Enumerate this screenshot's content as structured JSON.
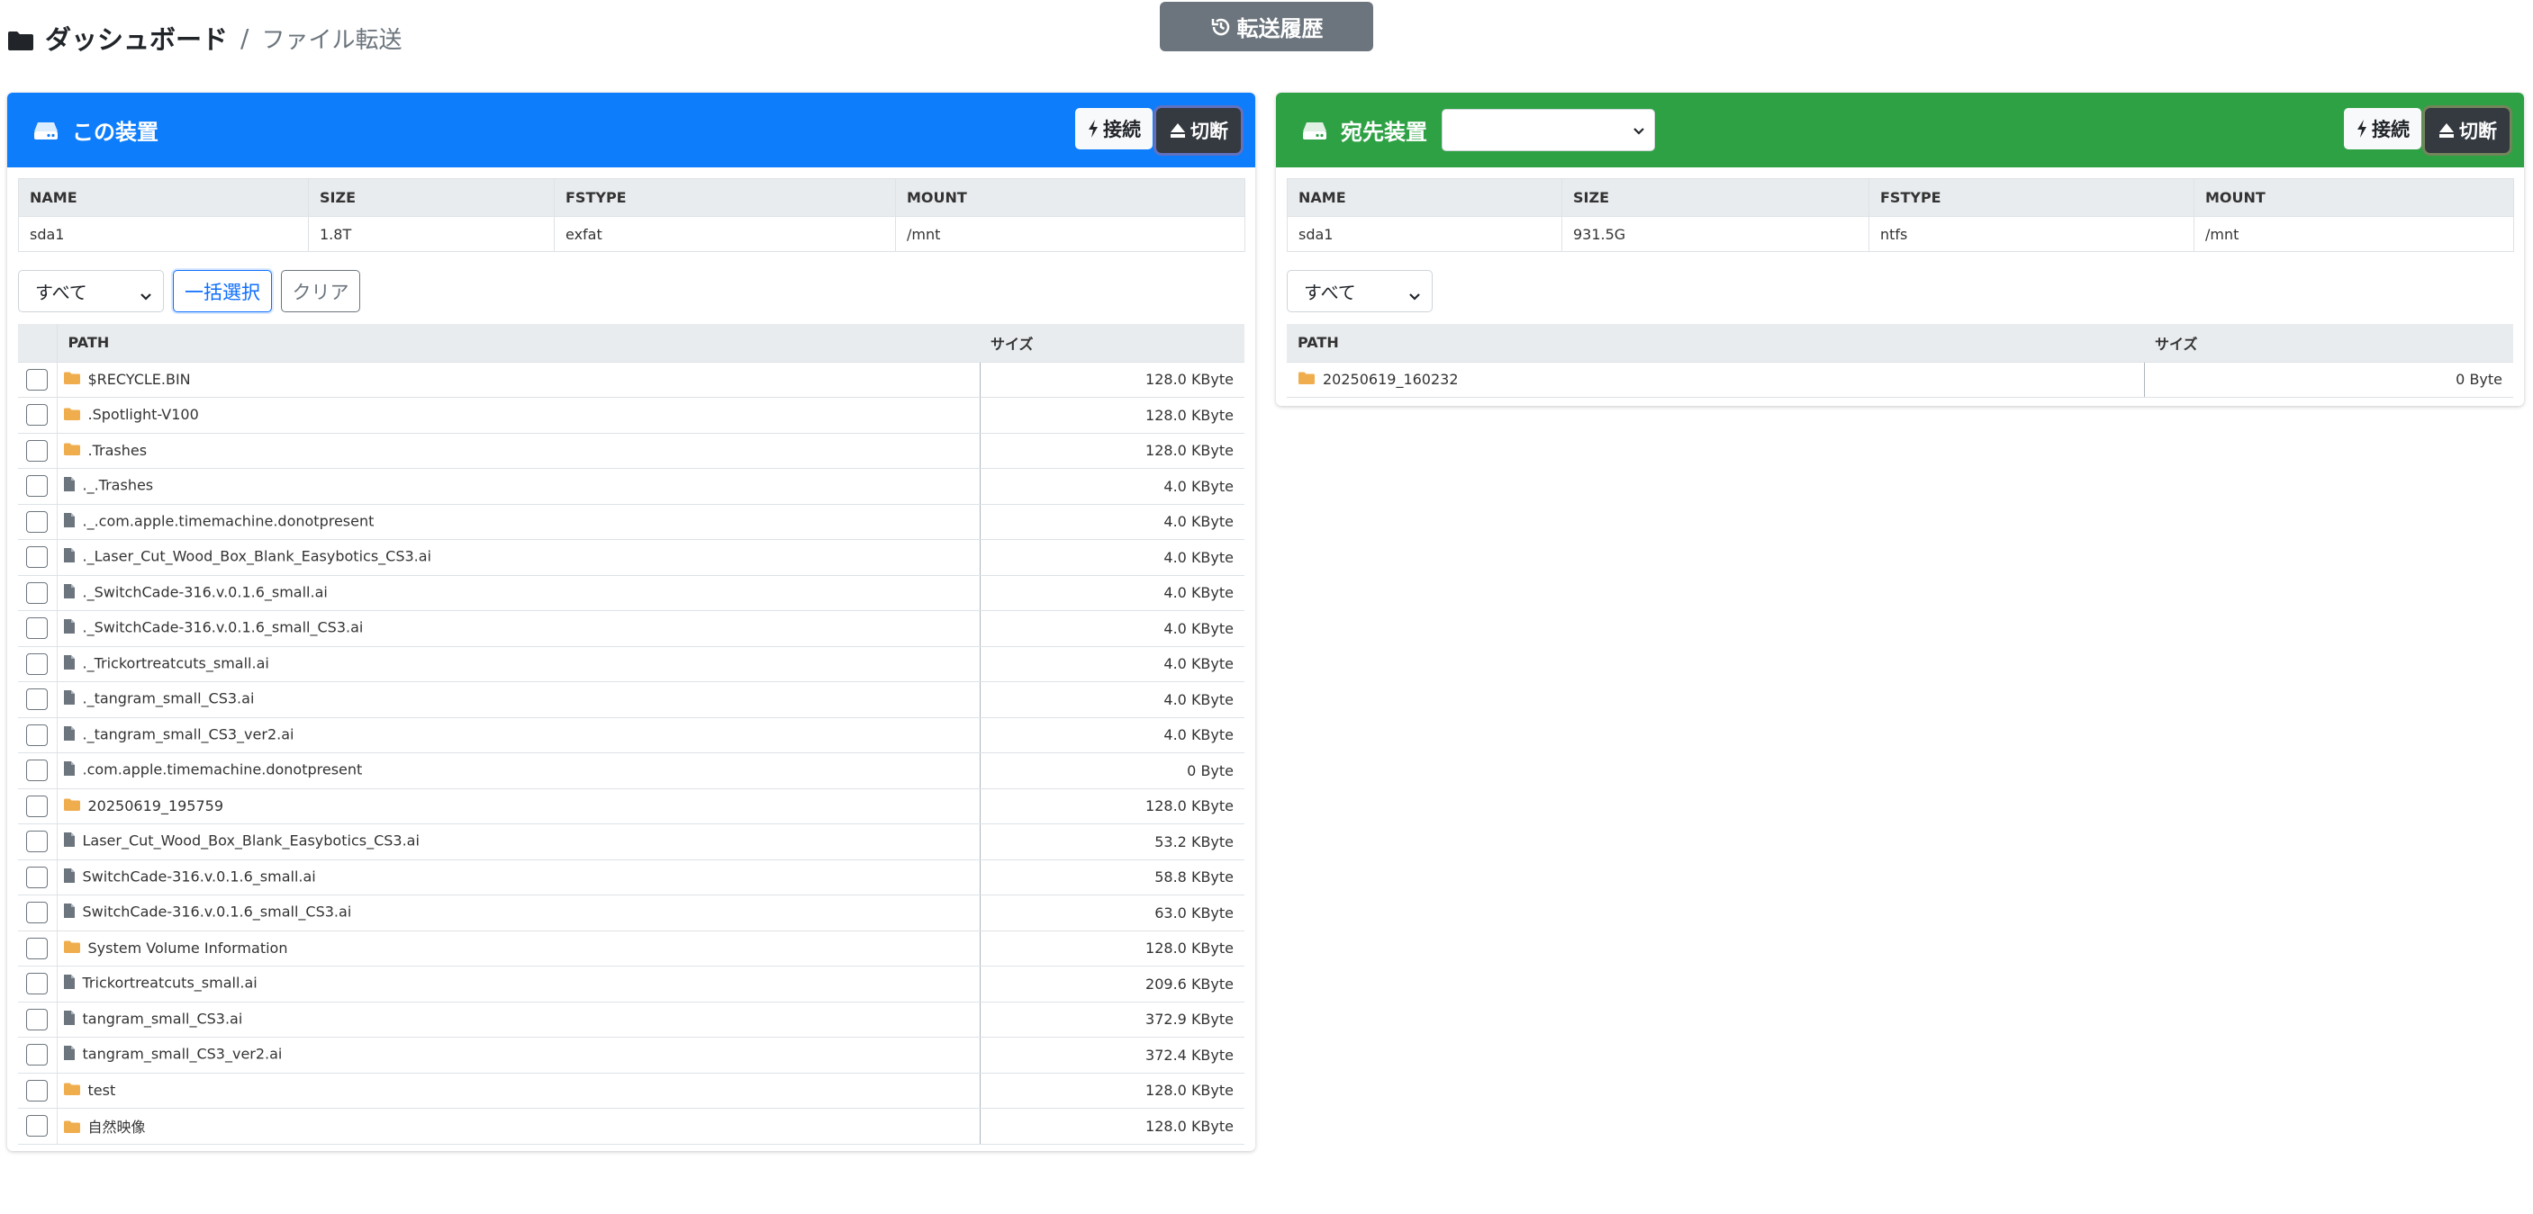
{
  "breadcrumb": {
    "home": "ダッシュボード",
    "separator": "/",
    "current": "ファイル転送"
  },
  "history_button": {
    "label": "転送履歴"
  },
  "left_panel": {
    "title": "この装置",
    "connect_label": "接続",
    "disconnect_label": "切断",
    "device_table": {
      "headers": [
        "NAME",
        "SIZE",
        "FSTYPE",
        "MOUNT"
      ],
      "row": [
        "sda1",
        "1.8T",
        "exfat",
        "/mnt"
      ]
    },
    "filter_value": "すべて",
    "select_all_label": "一括選択",
    "clear_label": "クリア",
    "file_table": {
      "headers": [
        "PATH",
        "サイズ"
      ],
      "rows": [
        {
          "type": "folder",
          "path": "$RECYCLE.BIN",
          "size": "128.0 KByte"
        },
        {
          "type": "folder",
          "path": ".Spotlight-V100",
          "size": "128.0 KByte"
        },
        {
          "type": "folder",
          "path": ".Trashes",
          "size": "128.0 KByte"
        },
        {
          "type": "file",
          "path": "._.Trashes",
          "size": "4.0 KByte"
        },
        {
          "type": "file",
          "path": "._.com.apple.timemachine.donotpresent",
          "size": "4.0 KByte"
        },
        {
          "type": "file",
          "path": "._Laser_Cut_Wood_Box_Blank_Easybotics_CS3.ai",
          "size": "4.0 KByte"
        },
        {
          "type": "file",
          "path": "._SwitchCade-316.v.0.1.6_small.ai",
          "size": "4.0 KByte"
        },
        {
          "type": "file",
          "path": "._SwitchCade-316.v.0.1.6_small_CS3.ai",
          "size": "4.0 KByte"
        },
        {
          "type": "file",
          "path": "._Trickortreatcuts_small.ai",
          "size": "4.0 KByte"
        },
        {
          "type": "file",
          "path": "._tangram_small_CS3.ai",
          "size": "4.0 KByte"
        },
        {
          "type": "file",
          "path": "._tangram_small_CS3_ver2.ai",
          "size": "4.0 KByte"
        },
        {
          "type": "file",
          "path": ".com.apple.timemachine.donotpresent",
          "size": "0 Byte"
        },
        {
          "type": "folder",
          "path": "20250619_195759",
          "size": "128.0 KByte"
        },
        {
          "type": "file",
          "path": "Laser_Cut_Wood_Box_Blank_Easybotics_CS3.ai",
          "size": "53.2 KByte"
        },
        {
          "type": "file",
          "path": "SwitchCade-316.v.0.1.6_small.ai",
          "size": "58.8 KByte"
        },
        {
          "type": "file",
          "path": "SwitchCade-316.v.0.1.6_small_CS3.ai",
          "size": "63.0 KByte"
        },
        {
          "type": "folder",
          "path": "System Volume Information",
          "size": "128.0 KByte"
        },
        {
          "type": "file",
          "path": "Trickortreatcuts_small.ai",
          "size": "209.6 KByte"
        },
        {
          "type": "file",
          "path": "tangram_small_CS3.ai",
          "size": "372.9 KByte"
        },
        {
          "type": "file",
          "path": "tangram_small_CS3_ver2.ai",
          "size": "372.4 KByte"
        },
        {
          "type": "folder",
          "path": "test",
          "size": "128.0 KByte"
        },
        {
          "type": "folder",
          "path": "自然映像",
          "size": "128.0 KByte"
        }
      ]
    }
  },
  "right_panel": {
    "title": "宛先装置",
    "dest_select_value": "",
    "connect_label": "接続",
    "disconnect_label": "切断",
    "device_table": {
      "headers": [
        "NAME",
        "SIZE",
        "FSTYPE",
        "MOUNT"
      ],
      "row": [
        "sda1",
        "931.5G",
        "ntfs",
        "/mnt"
      ]
    },
    "filter_value": "すべて",
    "file_table": {
      "headers": [
        "PATH",
        "サイズ"
      ],
      "rows": [
        {
          "type": "folder",
          "path": "20250619_160232",
          "size": "0 Byte"
        }
      ]
    }
  },
  "colors": {
    "left_header": "#0d7dfb",
    "right_header": "#2ea144",
    "history_button": "#6c757d",
    "disconnect_button": "#343a40",
    "folder_icon": "#f0ad4e",
    "file_icon": "#6c757d"
  },
  "icons": {
    "breadcrumb": "folder-icon",
    "history": "history-icon",
    "panel_header": "hdd-icon",
    "connect": "lightning-icon",
    "disconnect": "eject-icon",
    "folder_row": "folder-icon",
    "file_row": "file-icon"
  }
}
